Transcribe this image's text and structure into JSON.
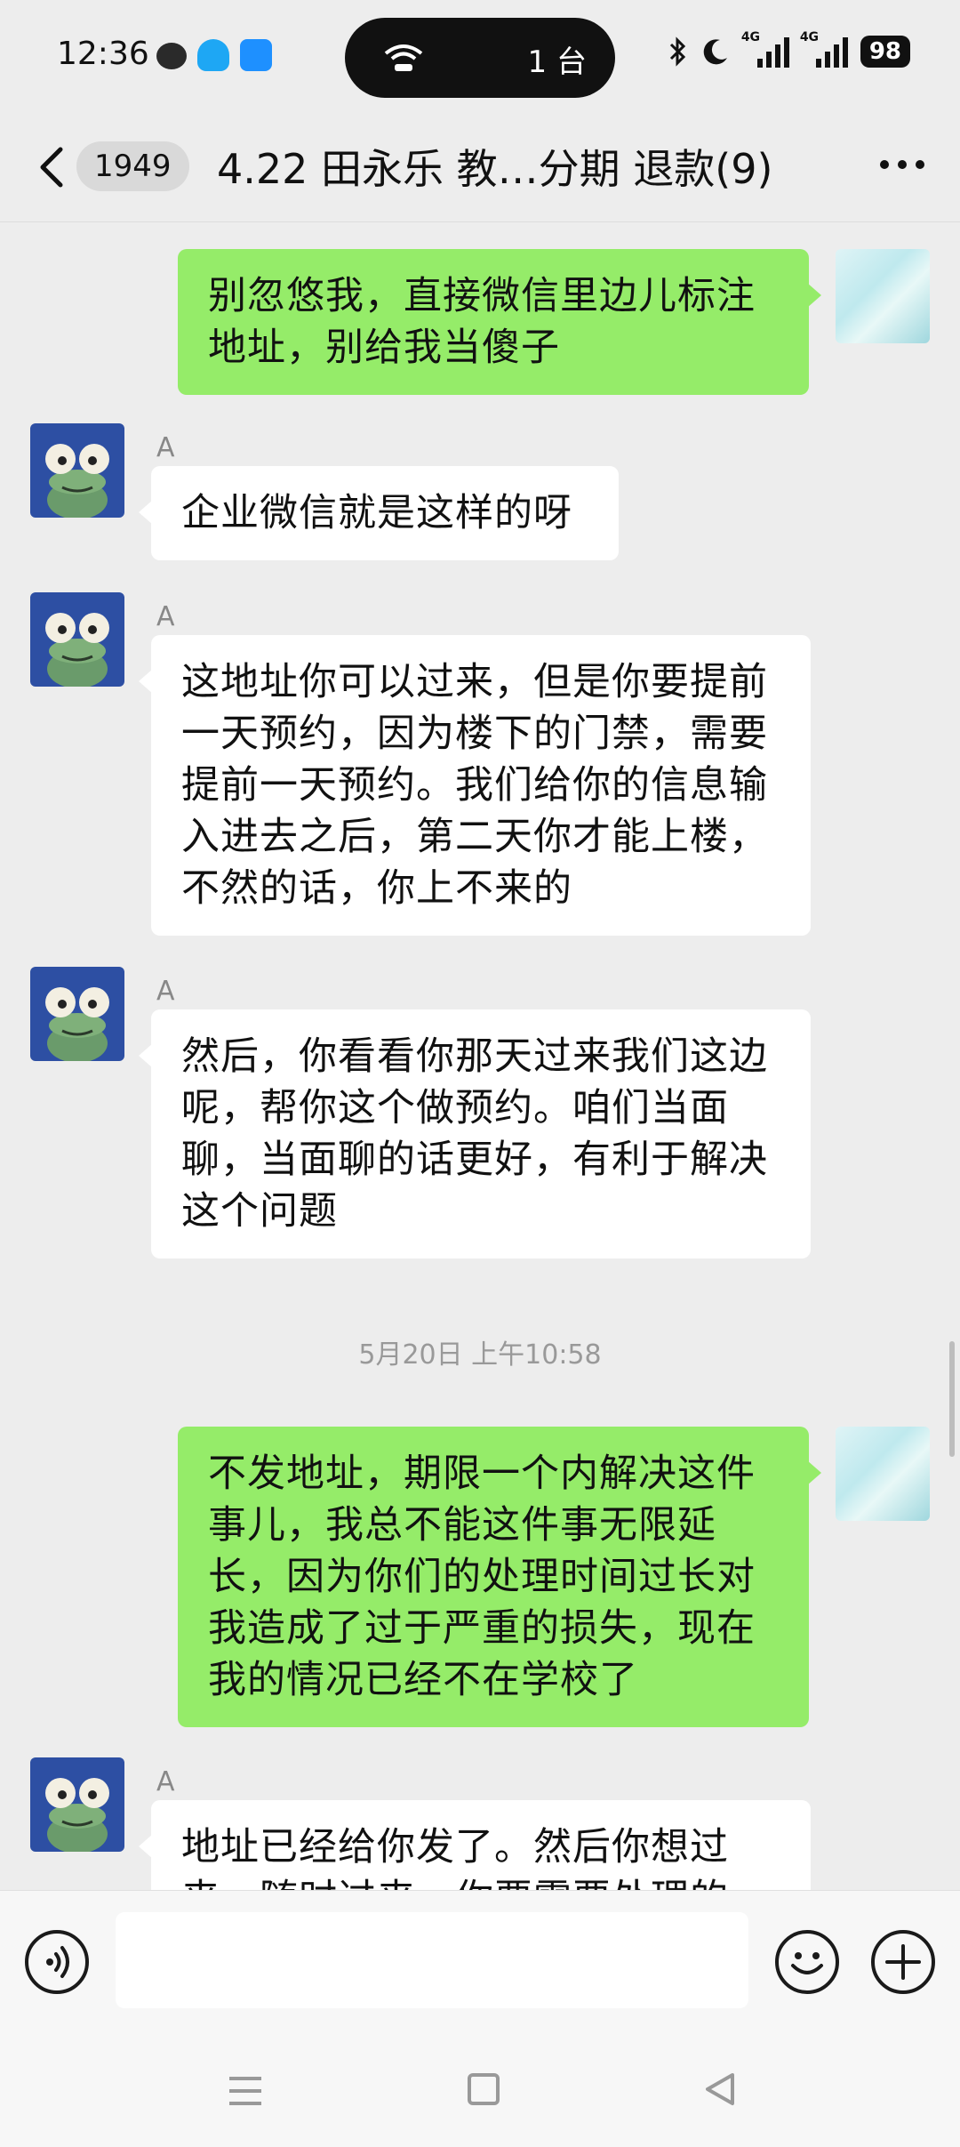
{
  "status_bar": {
    "time": "12:36",
    "app_icons": [
      "wechat-icon",
      "qq-icon",
      "bilibili-icon"
    ],
    "dynamic_island_text": "1 台",
    "network_labels": [
      "4G",
      "4G"
    ],
    "battery": "98"
  },
  "header": {
    "unread_count": "1949",
    "title": "4.22 田永乐 教…分期 退款(9)"
  },
  "messages": [
    {
      "side": "right",
      "text": "别忽悠我，直接微信里边儿标注地址，别给我当傻子"
    },
    {
      "side": "left",
      "sender": "A",
      "text": "企业微信就是这样的呀"
    },
    {
      "side": "left",
      "sender": "A",
      "text": "这地址你可以过来，但是你要提前一天预约，因为楼下的门禁，需要提前一天预约。我们给你的信息输入进去之后，第二天你才能上楼，不然的话，你上不来的"
    },
    {
      "side": "left",
      "sender": "A",
      "text": "然后，你看看你那天过来我们这边呢，帮你这个做预约。咱们当面聊，当面聊的话更好，有利于解决这个问题"
    },
    {
      "side": "right",
      "text": "不发地址，期限一个内解决这件事儿，我总不能这件事无限延长，因为你们的处理时间过长对我造成了过于严重的损失，现在我的情况已经不在学校了"
    },
    {
      "side": "left",
      "sender": "A",
      "text": "地址已经给你发了。然后你想过来，随时过来，你要需要处理的"
    }
  ],
  "timestamp": "5月20日 上午10:58",
  "input": {
    "value": "",
    "placeholder": ""
  },
  "colors": {
    "sent_bubble": "#95ec69",
    "received_bubble": "#ffffff",
    "background": "#ededed"
  }
}
